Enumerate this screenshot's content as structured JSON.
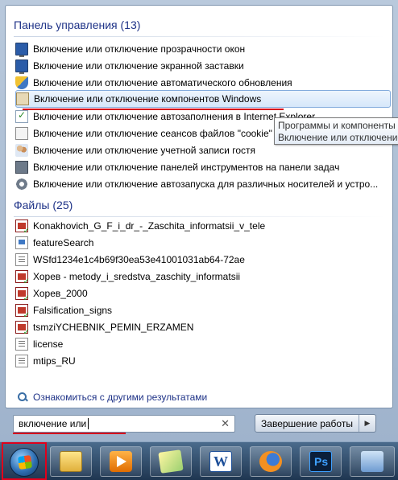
{
  "control_panel": {
    "header": "Панель управления (13)",
    "items": [
      {
        "label": "Включение или отключение прозрачности окон",
        "icon": "monitor-icon"
      },
      {
        "label": "Включение или отключение экранной заставки",
        "icon": "monitor-icon"
      },
      {
        "label": "Включение или отключение автоматического обновления",
        "icon": "shield-icon"
      },
      {
        "label": "Включение или отключение компонентов Windows",
        "icon": "box-icon",
        "selected": true
      },
      {
        "label": "Включение или отключение автозаполнения в Internet Explorer",
        "icon": "check-icon"
      },
      {
        "label": "Включение или отключение сеансов файлов \"cookie\"",
        "icon": "document-icon"
      },
      {
        "label": "Включение или отключение учетной записи гостя",
        "icon": "users-icon"
      },
      {
        "label": "Включение или отключение панелей инструментов на панели задач",
        "icon": "taskbar-icon"
      },
      {
        "label": "Включение или отключение автозапуска для различных носителей и устро...",
        "icon": "gear-icon"
      }
    ]
  },
  "tooltip": {
    "line1": "Программы и компоненты",
    "line2": "Включение или отключение"
  },
  "files": {
    "header": "Файлы (25)",
    "items": [
      {
        "label": "Konakhovich_G_F_i_dr_-_Zaschita_informatsii_v_tele",
        "icon": "pdf-icon"
      },
      {
        "label": "featureSearch",
        "icon": "file-icon"
      },
      {
        "label": "WSfd1234e1c4b69f30ea53e41001031ab64-72ae",
        "icon": "text-file-icon"
      },
      {
        "label": "Хорев - metody_i_sredstva_zaschity_informatsii",
        "icon": "pdf-icon"
      },
      {
        "label": "Хорев_2000",
        "icon": "pdf-icon"
      },
      {
        "label": "Falsification_signs",
        "icon": "pdf-icon"
      },
      {
        "label": "tsmziYCHEBNIK_PEMIN_ERZAMEN",
        "icon": "pdf-icon"
      },
      {
        "label": "license",
        "icon": "text-file-icon"
      },
      {
        "label": "mtips_RU",
        "icon": "text-file-icon"
      }
    ]
  },
  "see_more": "Ознакомиться с другими результатами",
  "search": {
    "value": "включение или",
    "clear_symbol": "✕"
  },
  "shutdown": {
    "label": "Завершение работы",
    "arrow": "▶"
  },
  "taskbar": {
    "buttons": [
      {
        "name": "windows-explorer",
        "icon": "folder-icon"
      },
      {
        "name": "windows-media-player",
        "icon": "media-player-icon"
      },
      {
        "name": "sticky-notes",
        "icon": "sticky-notes-icon"
      },
      {
        "name": "microsoft-word",
        "icon": "word-icon",
        "glyph": "W"
      },
      {
        "name": "firefox",
        "icon": "firefox-icon"
      },
      {
        "name": "photoshop",
        "icon": "photoshop-icon",
        "glyph": "Ps"
      },
      {
        "name": "control-panel",
        "icon": "control-panel-icon"
      }
    ]
  },
  "colors": {
    "header_text": "#1e3287",
    "selection_border": "#84acdd",
    "annotation_red": "#d6001c"
  }
}
